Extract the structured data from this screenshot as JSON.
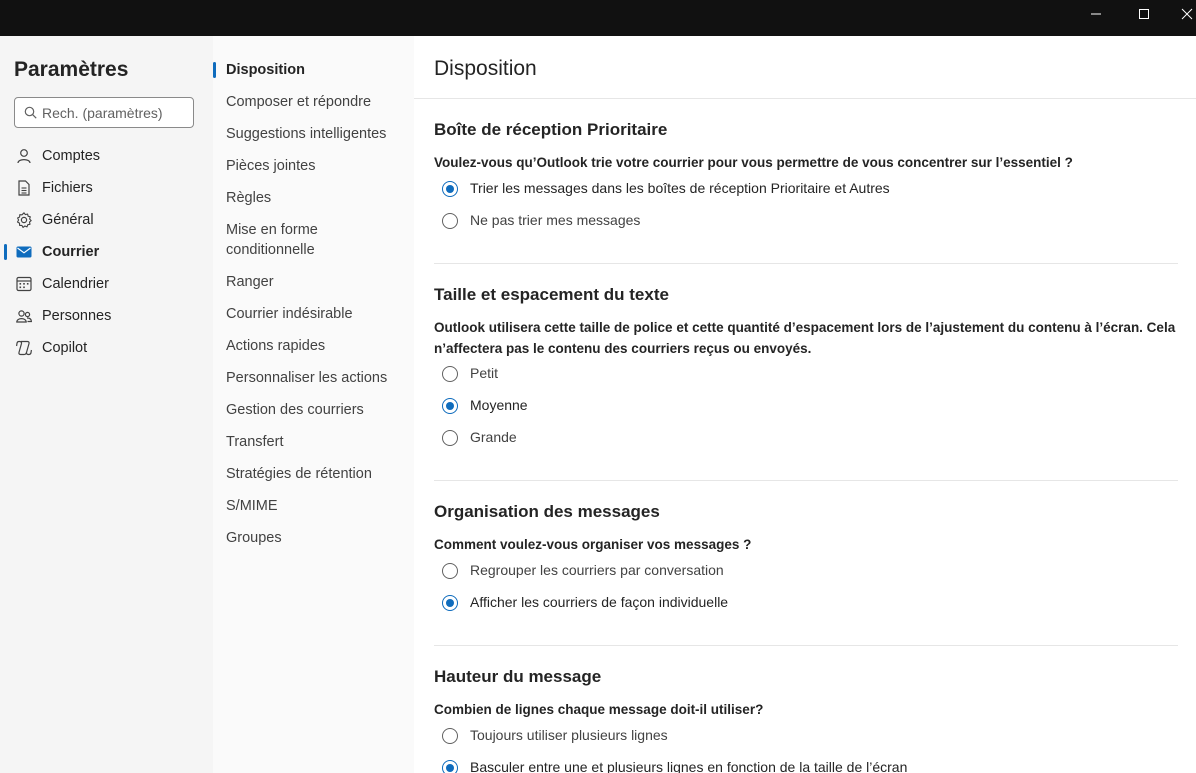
{
  "window": {
    "controls": [
      "minimize-icon",
      "maximize-icon",
      "close-icon"
    ]
  },
  "settings": {
    "title": "Paramètres",
    "search_placeholder": "Rech. (paramètres)"
  },
  "nav": {
    "items": [
      {
        "label": "Comptes",
        "icon": "person-icon"
      },
      {
        "label": "Fichiers",
        "icon": "document-icon"
      },
      {
        "label": "Général",
        "icon": "gear-icon"
      },
      {
        "label": "Courrier",
        "icon": "mail-icon",
        "active": true
      },
      {
        "label": "Calendrier",
        "icon": "calendar-icon"
      },
      {
        "label": "Personnes",
        "icon": "people-icon"
      },
      {
        "label": "Copilot",
        "icon": "copilot-icon"
      }
    ]
  },
  "subnav": {
    "items": [
      {
        "label": "Disposition",
        "active": true
      },
      {
        "label": "Composer et répondre"
      },
      {
        "label": "Suggestions intelligentes"
      },
      {
        "label": "Pièces jointes"
      },
      {
        "label": "Règles"
      },
      {
        "label": "Mise en forme conditionnelle"
      },
      {
        "label": "Ranger"
      },
      {
        "label": "Courrier indésirable"
      },
      {
        "label": "Actions rapides"
      },
      {
        "label": "Personnaliser les actions"
      },
      {
        "label": "Gestion des courriers"
      },
      {
        "label": "Transfert"
      },
      {
        "label": "Stratégies de rétention"
      },
      {
        "label": "S/MIME"
      },
      {
        "label": "Groupes"
      }
    ]
  },
  "content": {
    "title": "Disposition",
    "sections": [
      {
        "title": "Boîte de réception Prioritaire",
        "question": "Voulez-vous qu’Outlook trie votre courrier pour vous permettre de vous concentrer sur l’essentiel ?",
        "options": [
          {
            "label": "Trier les messages dans les boîtes de réception Prioritaire et Autres",
            "checked": true
          },
          {
            "label": "Ne pas trier mes messages",
            "checked": false
          }
        ]
      },
      {
        "title": "Taille et espacement du texte",
        "question": "Outlook utilisera cette taille de police et cette quantité d’espacement lors de l’ajustement du contenu à l’écran. Cela n’affectera pas le contenu des courriers reçus ou envoyés.",
        "options": [
          {
            "label": "Petit",
            "checked": false
          },
          {
            "label": "Moyenne",
            "checked": true
          },
          {
            "label": "Grande",
            "checked": false
          }
        ]
      },
      {
        "title": "Organisation des messages",
        "question": "Comment voulez-vous organiser vos messages ?",
        "options": [
          {
            "label": "Regrouper les courriers par conversation",
            "checked": false
          },
          {
            "label": "Afficher les courriers de façon individuelle",
            "checked": true
          }
        ]
      },
      {
        "title": "Hauteur du message",
        "question": "Combien de lignes chaque message doit-il utiliser?",
        "options": [
          {
            "label": "Toujours utiliser plusieurs lignes",
            "checked": false
          },
          {
            "label": "Basculer entre une et plusieurs lignes en fonction de la taille de l’écran",
            "checked": true
          }
        ]
      }
    ]
  },
  "colors": {
    "accent": "#0f6cbd",
    "titlebar": "#111111",
    "nav_bg": "#f5f5f5",
    "subnav_bg": "#fafafa"
  }
}
